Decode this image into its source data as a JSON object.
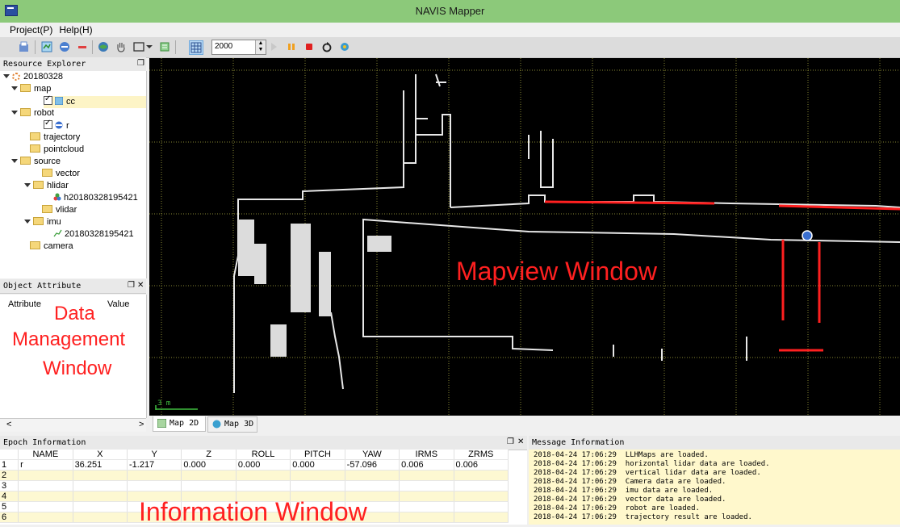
{
  "window": {
    "title": "NAVIS Mapper"
  },
  "menu": [
    "Project(P)",
    "Help(H)"
  ],
  "toolbar": {
    "zoom_value": "2000"
  },
  "resource_explorer": {
    "title": "Resource Explorer",
    "tree": [
      {
        "label": "20180328"
      },
      {
        "label": "map"
      },
      {
        "label": "cc"
      },
      {
        "label": "robot"
      },
      {
        "label": "r"
      },
      {
        "label": "trajectory"
      },
      {
        "label": "pointcloud"
      },
      {
        "label": "source"
      },
      {
        "label": "vector"
      },
      {
        "label": "hlidar"
      },
      {
        "label": "h20180328195421"
      },
      {
        "label": "vlidar"
      },
      {
        "label": "imu"
      },
      {
        "label": "20180328195421"
      },
      {
        "label": "camera"
      }
    ]
  },
  "object_attribute": {
    "title": "Object Attribute",
    "col_attribute": "Attribute",
    "col_value": "Value"
  },
  "overlays": {
    "data_mgmt": [
      "Data",
      "Management",
      "Window"
    ],
    "mapview": "Mapview Window",
    "info": "Information Window"
  },
  "map": {
    "scale_label": "3 m",
    "tabs": [
      "Map 2D",
      "Map 3D"
    ]
  },
  "epoch": {
    "title": "Epoch Information",
    "headers": [
      "NAME",
      "X",
      "Y",
      "Z",
      "ROLL",
      "PITCH",
      "YAW",
      "IRMS",
      "ZRMS"
    ],
    "row_numbers": [
      "1",
      "2",
      "3",
      "4",
      "5",
      "6"
    ],
    "rows": [
      [
        "r",
        "36.251",
        "-1.217",
        "0.000",
        "0.000",
        "0.000",
        "-57.096",
        "0.006",
        "0.006"
      ]
    ]
  },
  "messages": {
    "title": "Message Information",
    "lines": [
      "2018-04-24 17:06:29  LLHMaps are loaded.",
      "2018-04-24 17:06:29  horizontal lidar data are loaded.",
      "2018-04-24 17:06:29  vertical lidar data are loaded.",
      "2018-04-24 17:06:29  Camera data are loaded.",
      "2018-04-24 17:06:29  imu data are loaded.",
      "2018-04-24 17:06:29  vector data are loaded.",
      "2018-04-24 17:06:29  robot are loaded.",
      "2018-04-24 17:06:29  trajectory result are loaded."
    ]
  }
}
